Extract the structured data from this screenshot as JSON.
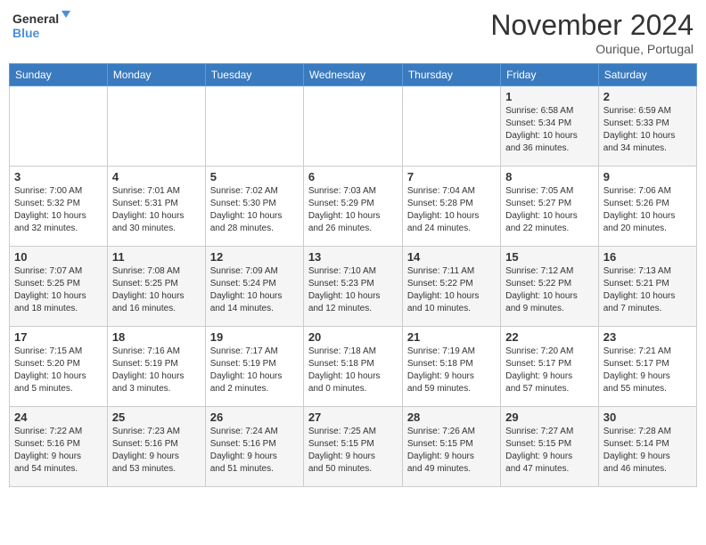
{
  "logo": {
    "line1": "General",
    "line2": "Blue"
  },
  "header": {
    "month": "November 2024",
    "location": "Ourique, Portugal"
  },
  "weekdays": [
    "Sunday",
    "Monday",
    "Tuesday",
    "Wednesday",
    "Thursday",
    "Friday",
    "Saturday"
  ],
  "weeks": [
    [
      {
        "day": "",
        "info": ""
      },
      {
        "day": "",
        "info": ""
      },
      {
        "day": "",
        "info": ""
      },
      {
        "day": "",
        "info": ""
      },
      {
        "day": "",
        "info": ""
      },
      {
        "day": "1",
        "info": "Sunrise: 6:58 AM\nSunset: 5:34 PM\nDaylight: 10 hours\nand 36 minutes."
      },
      {
        "day": "2",
        "info": "Sunrise: 6:59 AM\nSunset: 5:33 PM\nDaylight: 10 hours\nand 34 minutes."
      }
    ],
    [
      {
        "day": "3",
        "info": "Sunrise: 7:00 AM\nSunset: 5:32 PM\nDaylight: 10 hours\nand 32 minutes."
      },
      {
        "day": "4",
        "info": "Sunrise: 7:01 AM\nSunset: 5:31 PM\nDaylight: 10 hours\nand 30 minutes."
      },
      {
        "day": "5",
        "info": "Sunrise: 7:02 AM\nSunset: 5:30 PM\nDaylight: 10 hours\nand 28 minutes."
      },
      {
        "day": "6",
        "info": "Sunrise: 7:03 AM\nSunset: 5:29 PM\nDaylight: 10 hours\nand 26 minutes."
      },
      {
        "day": "7",
        "info": "Sunrise: 7:04 AM\nSunset: 5:28 PM\nDaylight: 10 hours\nand 24 minutes."
      },
      {
        "day": "8",
        "info": "Sunrise: 7:05 AM\nSunset: 5:27 PM\nDaylight: 10 hours\nand 22 minutes."
      },
      {
        "day": "9",
        "info": "Sunrise: 7:06 AM\nSunset: 5:26 PM\nDaylight: 10 hours\nand 20 minutes."
      }
    ],
    [
      {
        "day": "10",
        "info": "Sunrise: 7:07 AM\nSunset: 5:25 PM\nDaylight: 10 hours\nand 18 minutes."
      },
      {
        "day": "11",
        "info": "Sunrise: 7:08 AM\nSunset: 5:25 PM\nDaylight: 10 hours\nand 16 minutes."
      },
      {
        "day": "12",
        "info": "Sunrise: 7:09 AM\nSunset: 5:24 PM\nDaylight: 10 hours\nand 14 minutes."
      },
      {
        "day": "13",
        "info": "Sunrise: 7:10 AM\nSunset: 5:23 PM\nDaylight: 10 hours\nand 12 minutes."
      },
      {
        "day": "14",
        "info": "Sunrise: 7:11 AM\nSunset: 5:22 PM\nDaylight: 10 hours\nand 10 minutes."
      },
      {
        "day": "15",
        "info": "Sunrise: 7:12 AM\nSunset: 5:22 PM\nDaylight: 10 hours\nand 9 minutes."
      },
      {
        "day": "16",
        "info": "Sunrise: 7:13 AM\nSunset: 5:21 PM\nDaylight: 10 hours\nand 7 minutes."
      }
    ],
    [
      {
        "day": "17",
        "info": "Sunrise: 7:15 AM\nSunset: 5:20 PM\nDaylight: 10 hours\nand 5 minutes."
      },
      {
        "day": "18",
        "info": "Sunrise: 7:16 AM\nSunset: 5:19 PM\nDaylight: 10 hours\nand 3 minutes."
      },
      {
        "day": "19",
        "info": "Sunrise: 7:17 AM\nSunset: 5:19 PM\nDaylight: 10 hours\nand 2 minutes."
      },
      {
        "day": "20",
        "info": "Sunrise: 7:18 AM\nSunset: 5:18 PM\nDaylight: 10 hours\nand 0 minutes."
      },
      {
        "day": "21",
        "info": "Sunrise: 7:19 AM\nSunset: 5:18 PM\nDaylight: 9 hours\nand 59 minutes."
      },
      {
        "day": "22",
        "info": "Sunrise: 7:20 AM\nSunset: 5:17 PM\nDaylight: 9 hours\nand 57 minutes."
      },
      {
        "day": "23",
        "info": "Sunrise: 7:21 AM\nSunset: 5:17 PM\nDaylight: 9 hours\nand 55 minutes."
      }
    ],
    [
      {
        "day": "24",
        "info": "Sunrise: 7:22 AM\nSunset: 5:16 PM\nDaylight: 9 hours\nand 54 minutes."
      },
      {
        "day": "25",
        "info": "Sunrise: 7:23 AM\nSunset: 5:16 PM\nDaylight: 9 hours\nand 53 minutes."
      },
      {
        "day": "26",
        "info": "Sunrise: 7:24 AM\nSunset: 5:16 PM\nDaylight: 9 hours\nand 51 minutes."
      },
      {
        "day": "27",
        "info": "Sunrise: 7:25 AM\nSunset: 5:15 PM\nDaylight: 9 hours\nand 50 minutes."
      },
      {
        "day": "28",
        "info": "Sunrise: 7:26 AM\nSunset: 5:15 PM\nDaylight: 9 hours\nand 49 minutes."
      },
      {
        "day": "29",
        "info": "Sunrise: 7:27 AM\nSunset: 5:15 PM\nDaylight: 9 hours\nand 47 minutes."
      },
      {
        "day": "30",
        "info": "Sunrise: 7:28 AM\nSunset: 5:14 PM\nDaylight: 9 hours\nand 46 minutes."
      }
    ]
  ]
}
